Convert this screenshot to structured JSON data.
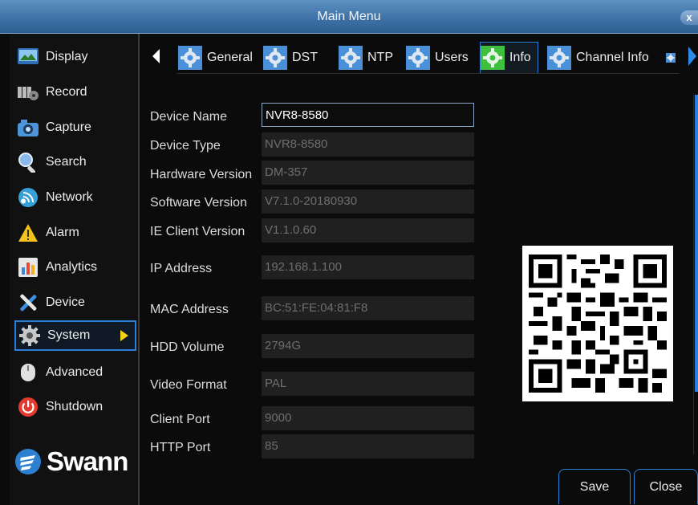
{
  "window": {
    "title": "Main Menu",
    "close_glyph": "x"
  },
  "sidebar": {
    "items": [
      {
        "label": "Display",
        "icon": "display-icon"
      },
      {
        "label": "Record",
        "icon": "record-icon"
      },
      {
        "label": "Capture",
        "icon": "camera-icon"
      },
      {
        "label": "Search",
        "icon": "search-icon"
      },
      {
        "label": "Network",
        "icon": "network-icon"
      },
      {
        "label": "Alarm",
        "icon": "alarm-icon"
      },
      {
        "label": "Analytics",
        "icon": "analytics-icon"
      },
      {
        "label": "Device",
        "icon": "device-icon"
      },
      {
        "label": "System",
        "icon": "system-icon",
        "active": true
      },
      {
        "label": "Advanced",
        "icon": "advanced-icon"
      },
      {
        "label": "Shutdown",
        "icon": "power-icon"
      }
    ],
    "logo": "Swann"
  },
  "tabs": {
    "items": [
      {
        "label": "General"
      },
      {
        "label": "DST"
      },
      {
        "label": "NTP"
      },
      {
        "label": "Users"
      },
      {
        "label": "Info",
        "active": true
      },
      {
        "label": "Channel Info"
      }
    ]
  },
  "info": {
    "fields": [
      {
        "label": "Device Name",
        "value": "NVR8-8580",
        "editable": true
      },
      {
        "label": "Device Type",
        "value": "NVR8-8580"
      },
      {
        "label": "Hardware Version",
        "value": "DM-357"
      },
      {
        "label": "Software Version",
        "value": "V7.1.0-20180930"
      },
      {
        "label": "IE Client Version",
        "value": "V1.1.0.60"
      },
      {
        "label": "IP Address",
        "value": "192.168.1.100"
      },
      {
        "label": "MAC Address",
        "value": "BC:51:FE:04:81:F8"
      },
      {
        "label": "HDD Volume",
        "value": "2794G"
      },
      {
        "label": "Video Format",
        "value": "PAL"
      },
      {
        "label": "Client Port",
        "value": "9000"
      },
      {
        "label": "HTTP Port",
        "value": "85"
      }
    ]
  },
  "buttons": {
    "save": "Save",
    "close": "Close"
  },
  "colors": {
    "accent": "#2b7fd6",
    "title_bar": "#3f72a6",
    "active_arrow": "#f5d21a",
    "tab_icon_active": "#3fbf3f"
  }
}
